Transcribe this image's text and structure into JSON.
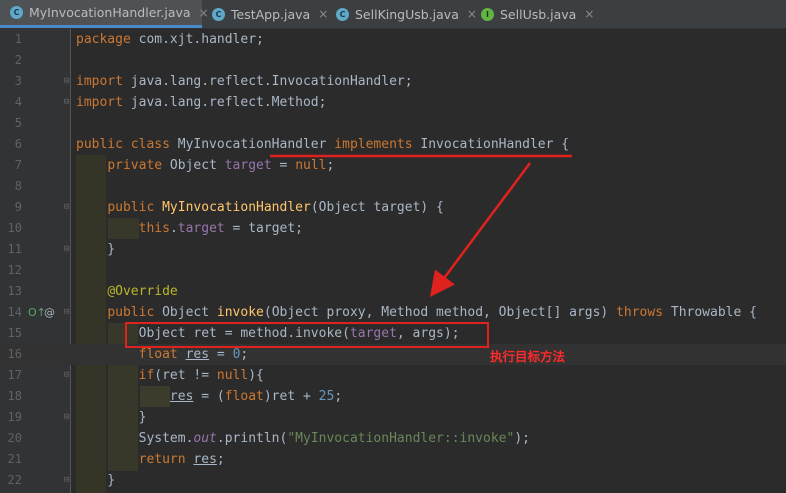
{
  "tabs": [
    {
      "label": "MyInvocationHandler.java",
      "icon": "class-icon",
      "active": true
    },
    {
      "label": "TestApp.java",
      "icon": "class-icon",
      "active": false
    },
    {
      "label": "SellKingUsb.java",
      "icon": "class-icon",
      "active": false
    },
    {
      "label": "SellUsb.java",
      "icon": "interface-icon",
      "active": false
    }
  ],
  "tab_icon_glyphs": {
    "class": "C",
    "interface": "I"
  },
  "close_glyph": "×",
  "line_numbers": [
    "1",
    "2",
    "3",
    "4",
    "5",
    "6",
    "7",
    "8",
    "9",
    "10",
    "11",
    "12",
    "13",
    "14",
    "15",
    "16",
    "17",
    "18",
    "19",
    "20",
    "21",
    "22"
  ],
  "annotation": {
    "text": "执行目标方法",
    "color": "#ff2a2a"
  },
  "gutter_markers": {
    "override": "O↑",
    "annotation": "@"
  },
  "colors": {
    "background": "#2b2b2b",
    "keyword": "#cc7832",
    "method_decl": "#ffc66d",
    "field": "#9876aa",
    "number": "#6897bb",
    "string": "#6a8759",
    "annotation": "#bbb529",
    "plain": "#a9b7c6",
    "highlight": "#e0221f"
  }
}
